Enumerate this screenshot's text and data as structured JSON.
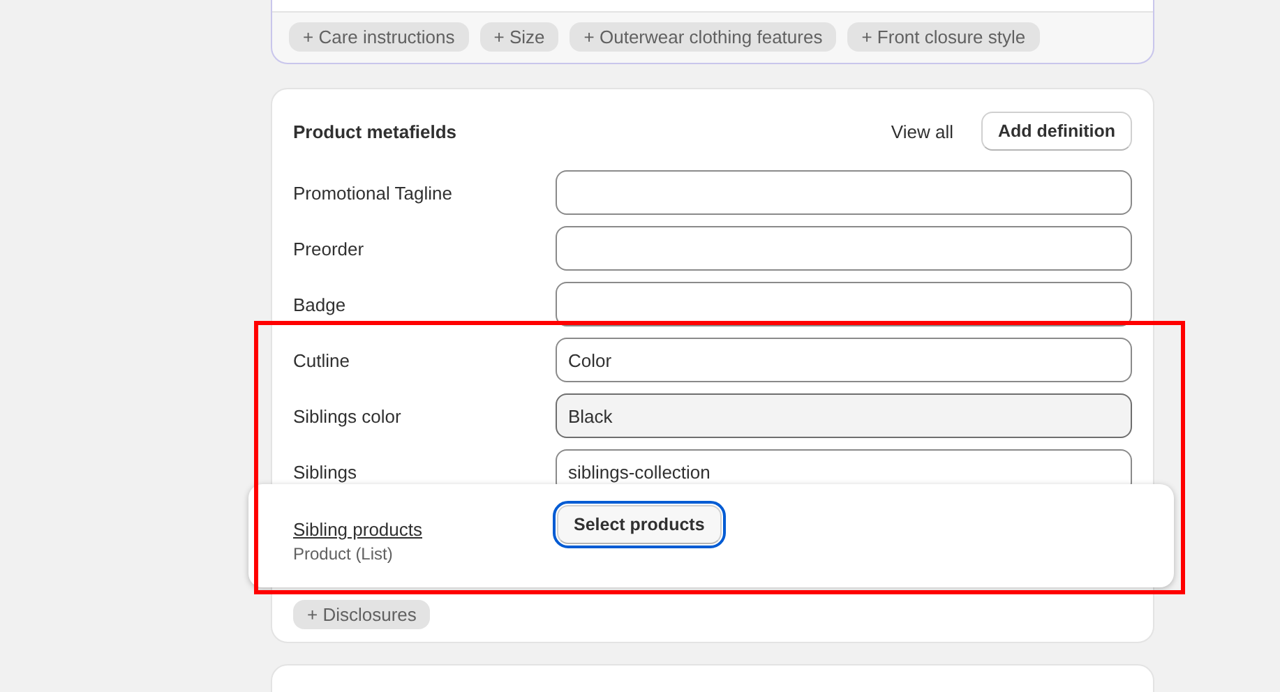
{
  "top_card": {
    "chips": [
      {
        "icon": "+",
        "label": "Care instructions"
      },
      {
        "icon": "+",
        "label": "Size"
      },
      {
        "icon": "+",
        "label": "Outerwear clothing features"
      },
      {
        "icon": "+",
        "label": "Front closure style"
      }
    ]
  },
  "metafields_card": {
    "title": "Product metafields",
    "view_all": "View all",
    "add_button": "Add definition",
    "rows": [
      {
        "label": "Promotional Tagline",
        "disabled": false
      },
      {
        "label": "Preorder",
        "disabled": false
      },
      {
        "label": "Badge",
        "disabled": false
      },
      {
        "label": "Cutline",
        "value": "Color",
        "disabled": false
      },
      {
        "label": "Siblings color",
        "value": "Black",
        "disabled": true
      },
      {
        "label": "Siblings",
        "value": "siblings-collection",
        "disabled": false
      }
    ],
    "chips": [
      {
        "icon": "+",
        "label": "Disclosures"
      }
    ],
    "dragged_row": {
      "label": "Sibling products",
      "type": "Product (List)",
      "button": "Select products"
    }
  }
}
